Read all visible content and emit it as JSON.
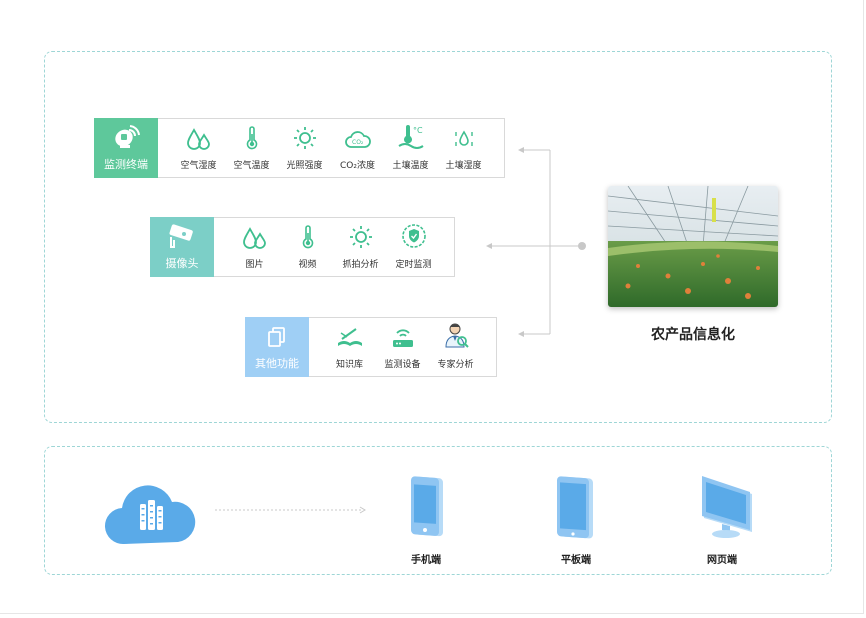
{
  "sections": {
    "monitor": {
      "title": "监测终端",
      "items": [
        {
          "label": "空气湿度",
          "icon": "humidity-drops-icon"
        },
        {
          "label": "空气温度",
          "icon": "thermometer-icon"
        },
        {
          "label": "光照强度",
          "icon": "sun-icon"
        },
        {
          "label": "CO₂浓度",
          "icon": "co2-cloud-icon"
        },
        {
          "label": "土壤温度",
          "icon": "soil-temperature-icon"
        },
        {
          "label": "土壤湿度",
          "icon": "soil-humidity-icon"
        }
      ]
    },
    "camera": {
      "title": "摄像头",
      "items": [
        {
          "label": "图片",
          "icon": "humidity-drops-icon"
        },
        {
          "label": "视频",
          "icon": "thermometer-icon"
        },
        {
          "label": "抓拍分析",
          "icon": "sun-icon"
        },
        {
          "label": "定时监测",
          "icon": "shield-check-icon"
        }
      ]
    },
    "other": {
      "title": "其他功能",
      "items": [
        {
          "label": "知识库",
          "icon": "open-book-icon"
        },
        {
          "label": "监测设备",
          "icon": "router-device-icon"
        },
        {
          "label": "专家分析",
          "icon": "doctor-expert-icon"
        }
      ]
    }
  },
  "main": {
    "title": "农产品信息化",
    "image": "greenhouse-photo"
  },
  "devices": [
    {
      "label": "手机端",
      "icon": "phone-icon"
    },
    {
      "label": "平板端",
      "icon": "tablet-icon"
    },
    {
      "label": "网页端",
      "icon": "monitor-icon"
    }
  ],
  "colors": {
    "monitor_head": "#5ec89b",
    "camera_head": "#7ccfc7",
    "other_head": "#9fcff5",
    "icon_green": "#3fbf8f",
    "device_blue": "#6bb6f0",
    "border_dashed": "#9ed6d6"
  }
}
